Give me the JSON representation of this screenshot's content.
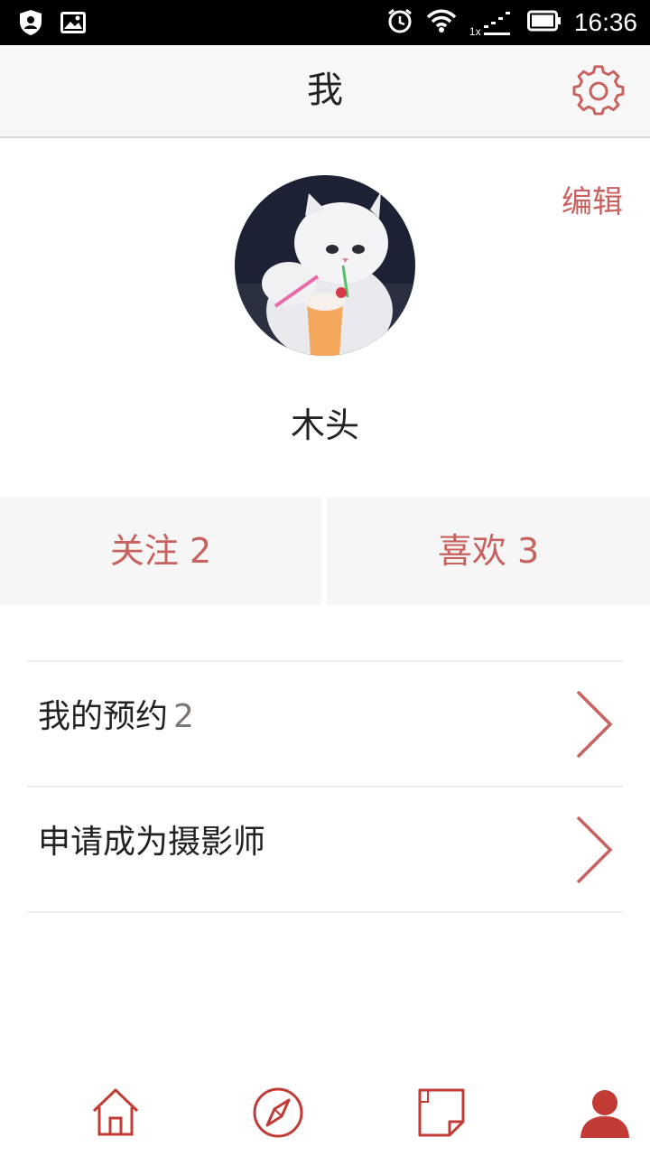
{
  "status_bar": {
    "time": "16:36",
    "network_label": "1x"
  },
  "header": {
    "title": "我",
    "settings_icon": "gear-icon"
  },
  "profile": {
    "edit_label": "编辑",
    "username": "木头",
    "avatar": "cat-avatar"
  },
  "stats": {
    "following": "关注 2",
    "likes": "喜欢 3"
  },
  "menu": {
    "items": [
      {
        "label": "我的预约",
        "count": "2"
      },
      {
        "label": "申请成为摄影师",
        "count": ""
      }
    ]
  },
  "bottom_nav": {
    "items": [
      "home-icon",
      "compass-icon",
      "note-icon",
      "profile-icon"
    ],
    "active": "profile-icon"
  },
  "colors": {
    "accent": "#c8625f",
    "nav_accent": "#c23b35",
    "header_bg": "#f7f7f7",
    "stat_bg": "#f6f6f6"
  }
}
